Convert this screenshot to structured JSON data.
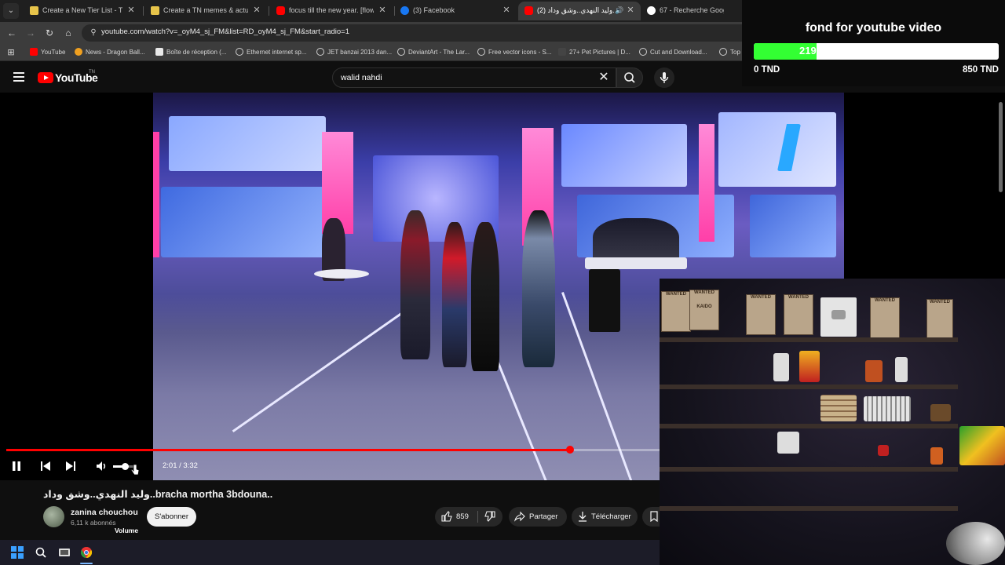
{
  "browser": {
    "tabs": [
      {
        "title": "Create a New Tier List - TierMaker",
        "favicon_color": "#e7c44a",
        "active": false
      },
      {
        "title": "Create a TN memes & actu 2023",
        "favicon_color": "#e7c44a",
        "active": false
      },
      {
        "title": "focus till the new year. [flow state]",
        "favicon_color": "#ff0000",
        "active": false
      },
      {
        "title": "(3) Facebook",
        "favicon_color": "#1877f2",
        "active": false
      },
      {
        "title": "(2) وليد النهدي..وشق وداد...be",
        "favicon_color": "#ff0000",
        "active": true
      },
      {
        "title": "67 - Recherche Google",
        "favicon_color": "#ffffff",
        "active": false
      }
    ],
    "url": "youtube.com/watch?v=_oyM4_sj_FM&list=RD_oyM4_sj_FM&start_radio=1",
    "bookmarks": [
      {
        "label": "YouTube",
        "icon_color": "#ff0000"
      },
      {
        "label": "News - Dragon Ball...",
        "icon_color": "#f0a020"
      },
      {
        "label": "Boîte de réception (...",
        "icon_color": "#e8e8e8"
      },
      {
        "label": "Ethernet internet sp...",
        "icon_color": "#cfcfcf"
      },
      {
        "label": "JET banzai 2013 dan...",
        "icon_color": "#cfcfcf"
      },
      {
        "label": "DeviantArt - The Lar...",
        "icon_color": "#cfcfcf"
      },
      {
        "label": "Free vector icons - S...",
        "icon_color": "#cfcfcf"
      },
      {
        "label": "27+ Pet Pictures | D...",
        "icon_color": "#cfcfcf"
      },
      {
        "label": "Cut and Download...",
        "icon_color": "#cfcfcf"
      },
      {
        "label": "Top",
        "icon_color": "#cfcfcf"
      }
    ]
  },
  "youtube": {
    "logo_text": "YouTube",
    "logo_superscript": "TN",
    "search_value": "walid nahdi",
    "player": {
      "volume_tooltip": "Volume",
      "time": "2:01 / 3:32",
      "progress_fraction": 0.863,
      "volume_fraction": 0.5
    },
    "video_title": "وليد النهدي..وشق وداد..bracha mortha 3bdouna..",
    "channel": {
      "name": "zanina chouchou",
      "subscribers": "6,11 k abonnés"
    },
    "subscribe_label": "S'abonner",
    "likes": "859",
    "share_label": "Partager",
    "download_label": "Télécharger"
  },
  "donation": {
    "heading": "fond for youtube video",
    "current": "219",
    "min_label": "0 TND",
    "max_label": "850 TND",
    "progress_fraction": 0.2576,
    "fill_color": "#33ff33"
  },
  "webcam": {
    "poster_text": "WANTED",
    "poster_names": [
      "KAIDO"
    ]
  },
  "colors": {
    "accent": "#ff0000",
    "background": "#0f0f0f"
  }
}
